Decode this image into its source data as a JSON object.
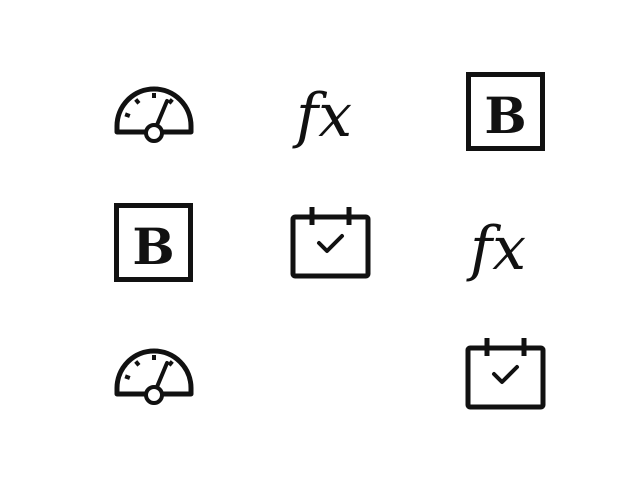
{
  "icons": {
    "color": "#111111",
    "fx_glyph": "fx",
    "bold_glyph": "B",
    "grid": [
      [
        "gauge-icon",
        "function-fx-icon",
        "bold-b-icon"
      ],
      [
        "bold-b-icon",
        "calendar-check-icon",
        "function-fx-icon"
      ],
      [
        "gauge-icon",
        "",
        "calendar-check-icon"
      ]
    ]
  }
}
